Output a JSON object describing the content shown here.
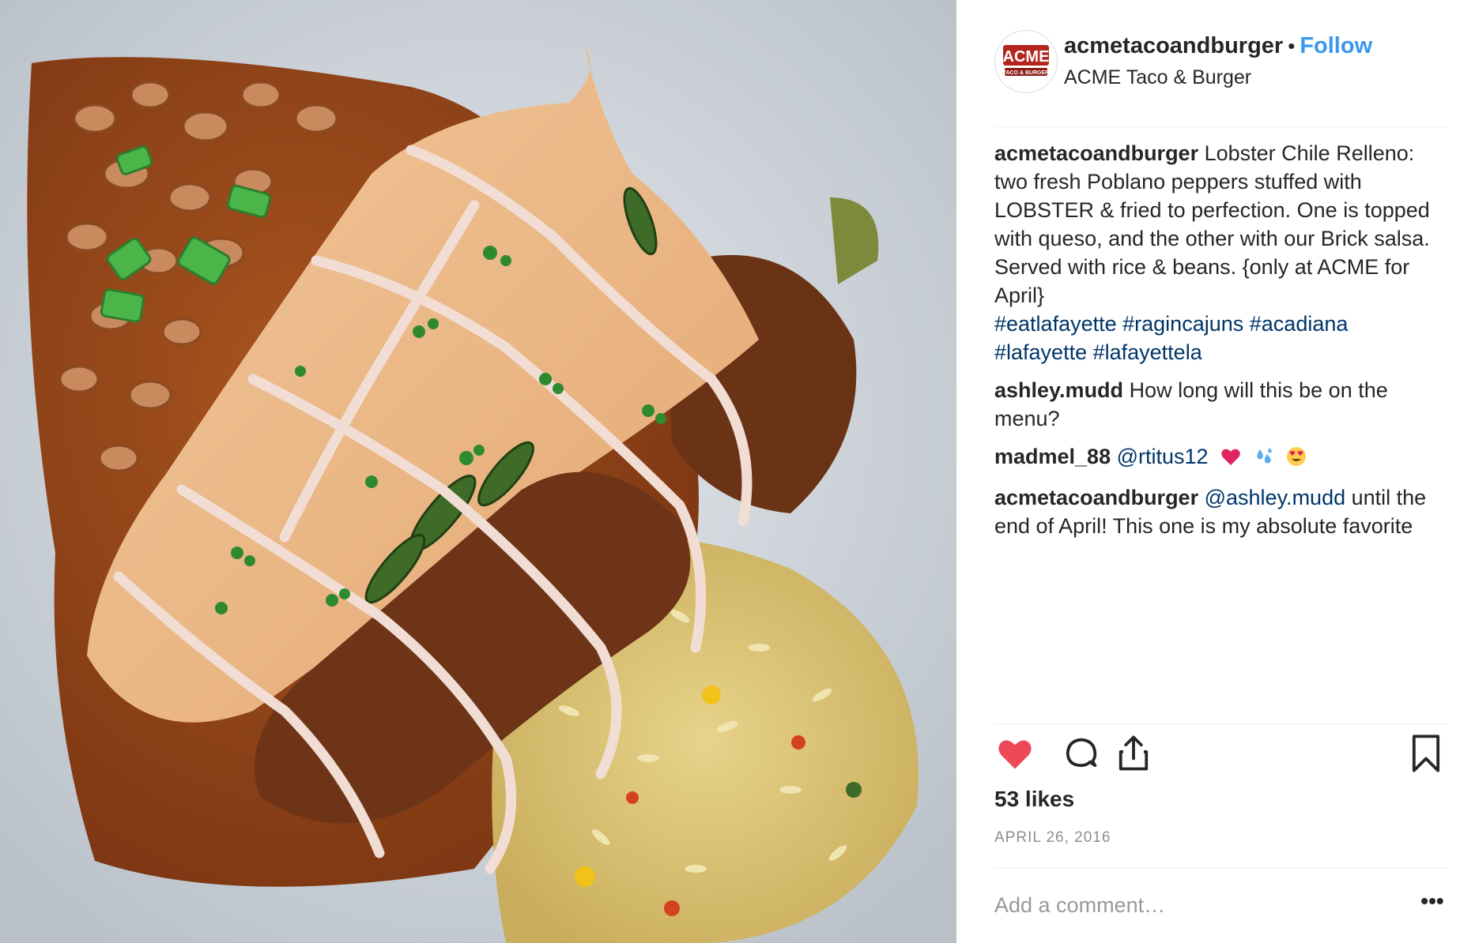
{
  "post": {
    "account": {
      "username": "acmetacoandburger",
      "separator": "•",
      "follow_label": "Follow",
      "location": "ACME Taco & Burger",
      "avatar": {
        "logo_text": "ACME",
        "logo_subtext": "TACO & BURGER"
      }
    },
    "photo": {
      "description": "food photo"
    },
    "comments": [
      {
        "user": "acmetacoandburger",
        "text": "Lobster Chile Relleno: two fresh Poblano peppers stuffed with LOBSTER & fried to perfection. One is topped with queso, and the other with our Brick salsa. Served with rice & beans. {only at ACME for April}",
        "hashtags": [
          "#eatlafayette",
          "#ragincajuns",
          "#acadiana",
          "#lafayette",
          "#lafayettela"
        ]
      },
      {
        "user": "ashley.mudd",
        "text": "How long will this be on the menu?"
      },
      {
        "user": "madmel_88",
        "mention": "@rtitus12",
        "emojis": [
          "heart-emoji",
          "sweat-droplets-emoji",
          "heart-eyes-emoji"
        ]
      },
      {
        "user": "acmetacoandburger",
        "mention": "@ashley.mudd",
        "text": "until the end of April! This one is my absolute favorite"
      }
    ],
    "actions": {
      "like_icon": "heart-icon",
      "like_color": "#ed4956",
      "comment_icon": "comment-icon",
      "share_icon": "share-icon",
      "save_icon": "bookmark-icon"
    },
    "likes": "53 likes",
    "date": "APRIL 26, 2016",
    "add_comment_placeholder": "Add a comment…",
    "more_label": "•••",
    "colors": {
      "link": "#3897f0",
      "hashtag": "#003569",
      "muted": "#8e8e8e"
    }
  }
}
